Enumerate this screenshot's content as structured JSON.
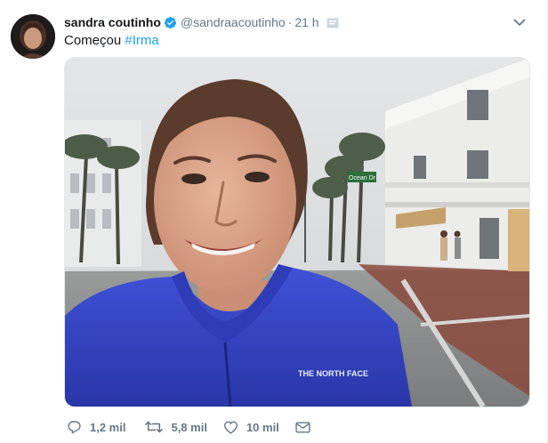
{
  "tweet": {
    "display_name": "sandra coutinho",
    "handle": "@sandraacoutinho",
    "separator": "·",
    "time": "21 h",
    "text_prefix": "Começou",
    "hashtag": "#Irma",
    "photo_street_sign": "Ocean Dr",
    "photo_jacket_logo": "THE NORTH FACE",
    "icons": {
      "verified": "verified-badge-icon",
      "translate": "translate-icon",
      "caret": "chevron-down-icon",
      "reply": "reply-icon",
      "retweet": "retweet-icon",
      "like": "heart-icon",
      "dm": "envelope-icon"
    },
    "colors": {
      "link": "#1da1f2",
      "muted": "#657786"
    }
  },
  "actions": {
    "reply_count": "1,2 mil",
    "retweet_count": "5,8 mil",
    "like_count": "10 mil"
  }
}
